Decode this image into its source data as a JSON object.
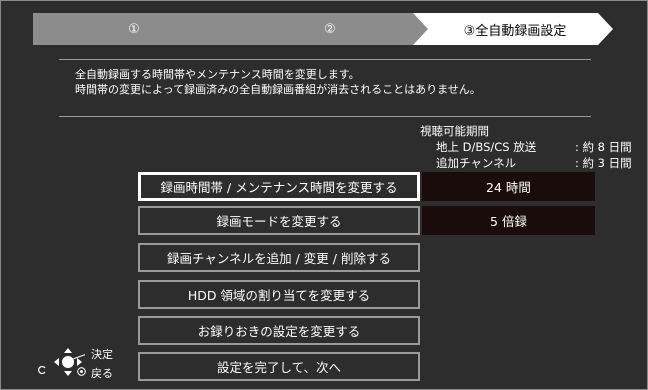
{
  "steps": [
    {
      "label": "①"
    },
    {
      "label": "②"
    },
    {
      "label": "③全自動録画設定",
      "active": true
    }
  ],
  "description": {
    "line1": "全自動録画する時間帯やメンテナンス時間を変更します。",
    "line2": "時間帯の変更によって録画済みの全自動録画番組が消去されることはありません。"
  },
  "viewing_period": {
    "title": "視聴可能期間",
    "terrestrial_label": "地上 D/BS/CS 放送",
    "terrestrial_value": ": 約 8 日間",
    "added_label": "追加チャンネル",
    "added_value": ": 約 3 日間"
  },
  "menu": [
    {
      "label": "録画時間帯 / メンテナンス時間を変更する",
      "value": "24 時間",
      "selected": true
    },
    {
      "label": "録画モードを変更する",
      "value": "5 倍録"
    },
    {
      "label": "録画チャンネルを追加 / 変更 / 削除する"
    },
    {
      "label": "HDD 領域の割り当てを変更する"
    },
    {
      "label": "お録りおきの設定を変更する"
    },
    {
      "label": "設定を完了して、次へ"
    }
  ],
  "nav_hint": {
    "decide": "決定",
    "back": "戻る",
    "icons": [
      "dpad-icon",
      "back-icon",
      "return-icon"
    ]
  },
  "colors": {
    "background": "#2d2d2d",
    "step_inactive": "#8c8c8c",
    "step_active": "#ffffff",
    "value_box": "#1a0c0a"
  }
}
